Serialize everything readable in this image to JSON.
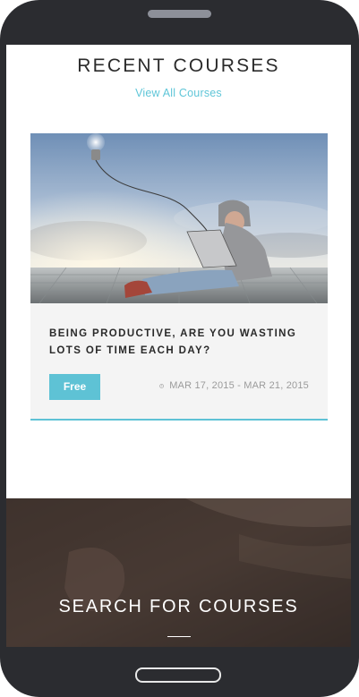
{
  "recent": {
    "title": "RECENT COURSES",
    "view_all": "View All Courses"
  },
  "course": {
    "title": "BEING PRODUCTIVE, ARE YOU WASTING LOTS OF TIME EACH DAY?",
    "price": "Free",
    "date": "MAR 17, 2015 - MAR 21, 2015",
    "icon": "clock-icon"
  },
  "search": {
    "title": "SEARCH FOR COURSES"
  },
  "colors": {
    "accent": "#5ec2d5",
    "frame": "#2b2c30",
    "text": "#2b2b2b",
    "muted": "#9b9b9b"
  }
}
